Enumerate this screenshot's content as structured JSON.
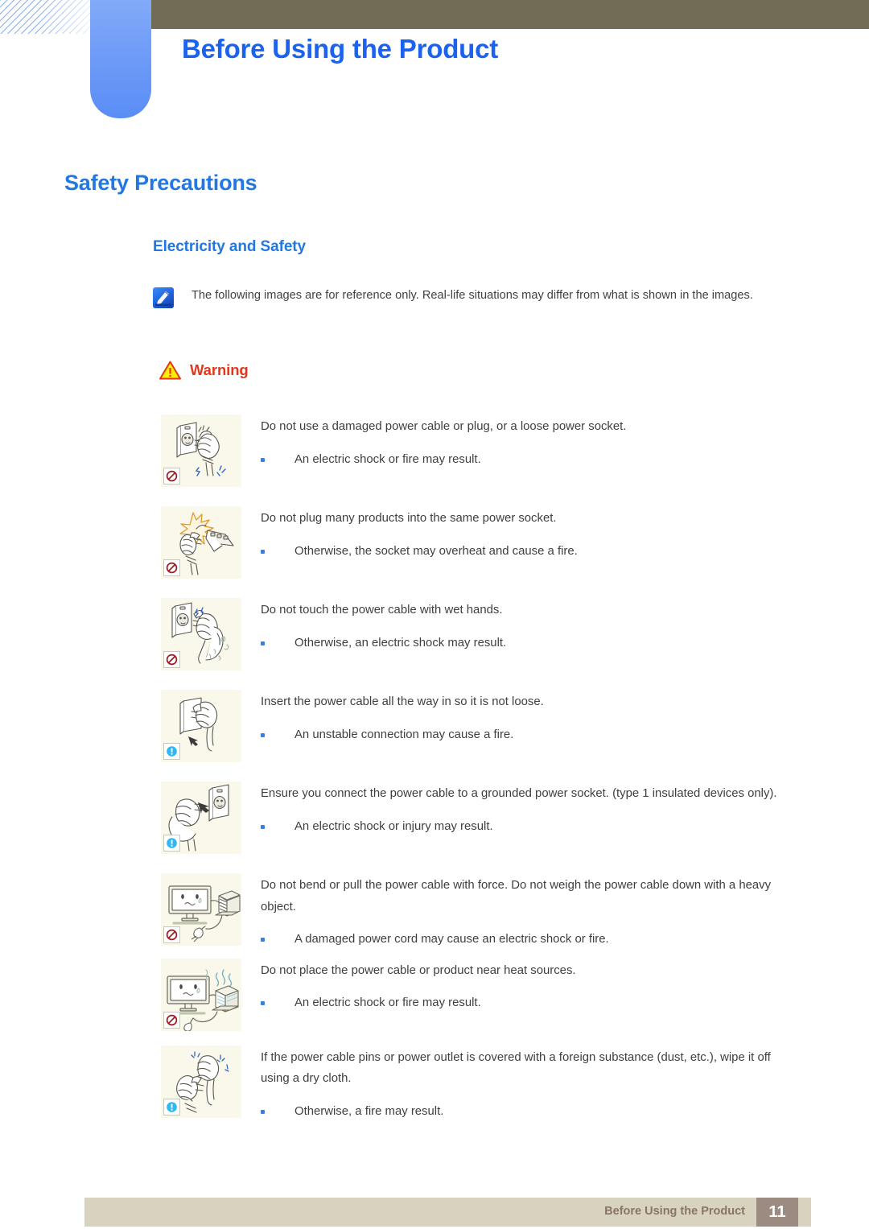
{
  "header": {
    "title": "Before Using the Product",
    "accent_blue": "#1b62ef",
    "tab_color": "#6e9cf7",
    "bar_color": "#706c56"
  },
  "section": {
    "title": "Safety Precautions",
    "subtitle": "Electricity and Safety",
    "heading_color": "#2277e0"
  },
  "note": {
    "icon": "note-pen-icon",
    "text": "The following images are for reference only. Real-life situations may differ from what is shown in the images."
  },
  "warning": {
    "icon": "warning-triangle-icon",
    "label": "Warning",
    "color": "#e2381a"
  },
  "items": [
    {
      "badge": "prohibition-icon",
      "illustration": "damaged-plug-and-socket",
      "lead": "Do not use a damaged power cable or plug, or a loose power socket.",
      "bullets": [
        "An electric shock or fire may result."
      ]
    },
    {
      "badge": "prohibition-icon",
      "illustration": "overloaded-power-strip",
      "lead": "Do not plug many products into the same power socket.",
      "bullets": [
        "Otherwise, the socket may overheat and cause a fire."
      ]
    },
    {
      "badge": "prohibition-icon",
      "illustration": "wet-hand-on-plug",
      "lead": "Do not touch the power cable with wet hands.",
      "bullets": [
        "Otherwise, an electric shock may result."
      ]
    },
    {
      "badge": "info-icon",
      "illustration": "plug-fully-inserted",
      "lead": "Insert the power cable all the way in so it is not loose.",
      "bullets": [
        "An unstable connection may cause a fire."
      ]
    },
    {
      "badge": "info-icon",
      "illustration": "grounded-socket-connection",
      "lead": "Ensure you connect the power cable to a grounded power socket. (type 1 insulated devices only).",
      "bullets": [
        "An electric shock or injury may result."
      ]
    },
    {
      "badge": "prohibition-icon",
      "illustration": "monitor-with-weight-on-cable",
      "lead": "Do not bend or pull the power cable with force. Do not weigh the power cable down with a heavy object.",
      "bullets": [
        "A damaged power cord may cause an electric shock or fire."
      ]
    },
    {
      "badge": "prohibition-icon",
      "illustration": "monitor-near-heat-source",
      "lead": "Do not place the power cable or product near heat sources.",
      "bullets": [
        "An electric shock or fire may result."
      ]
    },
    {
      "badge": "info-icon",
      "illustration": "wiping-plug-pins-with-cloth",
      "lead": "If the power cable pins or power outlet is covered with a foreign substance (dust, etc.), wipe it off using a dry cloth.",
      "bullets": [
        "Otherwise, a fire may result."
      ]
    }
  ],
  "footer": {
    "text": "Before Using the Product",
    "page": "11",
    "bar_color": "#d8d3bf",
    "page_box_color": "#9c8b80"
  }
}
